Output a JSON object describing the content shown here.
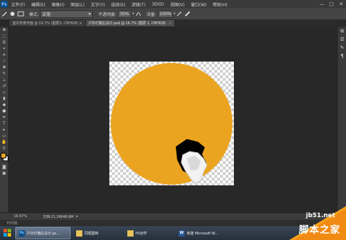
{
  "app": {
    "logo_text": "Ps"
  },
  "menubar": {
    "items": [
      "文件(F)",
      "编辑(E)",
      "图像(I)",
      "图层(L)",
      "文字(Y)",
      "选择(S)",
      "滤镜(T)",
      "3D(D)",
      "视图(V)",
      "窗口(W)",
      "帮助(H)"
    ],
    "window_buttons": [
      "—",
      "□",
      "✕"
    ]
  },
  "optionsbar": {
    "mode_label": "模式:",
    "mode_value": "正常",
    "opacity_label": "不透明度:",
    "opacity_value": "30%",
    "flow_label": "流量:",
    "flow_value": "100%"
  },
  "tabs": [
    {
      "label": "室外背景字面 @ 16.7% (图层3, CMYK/8) ×",
      "active": false
    },
    {
      "label": "户外灯箱左设计.psd @ 16.7% (图层 1, CMYK/8)",
      "active": true,
      "close": "×"
    }
  ],
  "document": {
    "circle_color": "#EBA41F"
  },
  "statusbar": {
    "zoom": "16.67%",
    "doc_info": "文档:21.2M/48.6M"
  },
  "timeline": {
    "label": "时间轴"
  },
  "taskbar": {
    "items": [
      {
        "icon": "Ps",
        "label": "户外灯箱左设计.ps...",
        "active": true
      },
      {
        "icon": "📁",
        "label": "同框图档",
        "active": false
      },
      {
        "icon": "📁",
        "label": "PS自学",
        "active": false
      },
      {
        "icon": "W",
        "label": "新建 Microsoft W...",
        "active": false
      }
    ]
  },
  "watermark": {
    "url": "jb51.net",
    "text": "脚本之家"
  }
}
